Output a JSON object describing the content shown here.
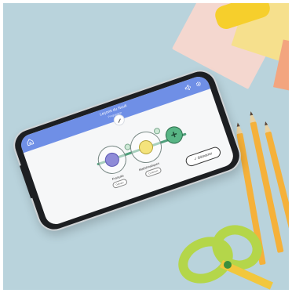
{
  "app": {
    "title": "Leçons du Nuuli",
    "subtitle": "Programme"
  },
  "toolbar": {
    "home_icon": "home-icon",
    "sound_icon": "sound-icon",
    "settings_icon": "gear-icon",
    "edit_icon": "pencil-icon"
  },
  "lesson_path": {
    "nodes": [
      {
        "label": "Français",
        "badge": "Débuter",
        "color": "#8f8bd8"
      },
      {
        "label": "Mathématiques",
        "badge": "Continuer",
        "color": "#f4e37c"
      },
      {
        "label": "",
        "badge": "",
        "color": "#58b585"
      }
    ],
    "add_icon": "+"
  },
  "actions": {
    "start_label": "Démarrer",
    "start_icon": "check-icon"
  },
  "colors": {
    "header": "#6f8fe6",
    "track": "#4f9f7b",
    "background": "#b9d3dc"
  }
}
